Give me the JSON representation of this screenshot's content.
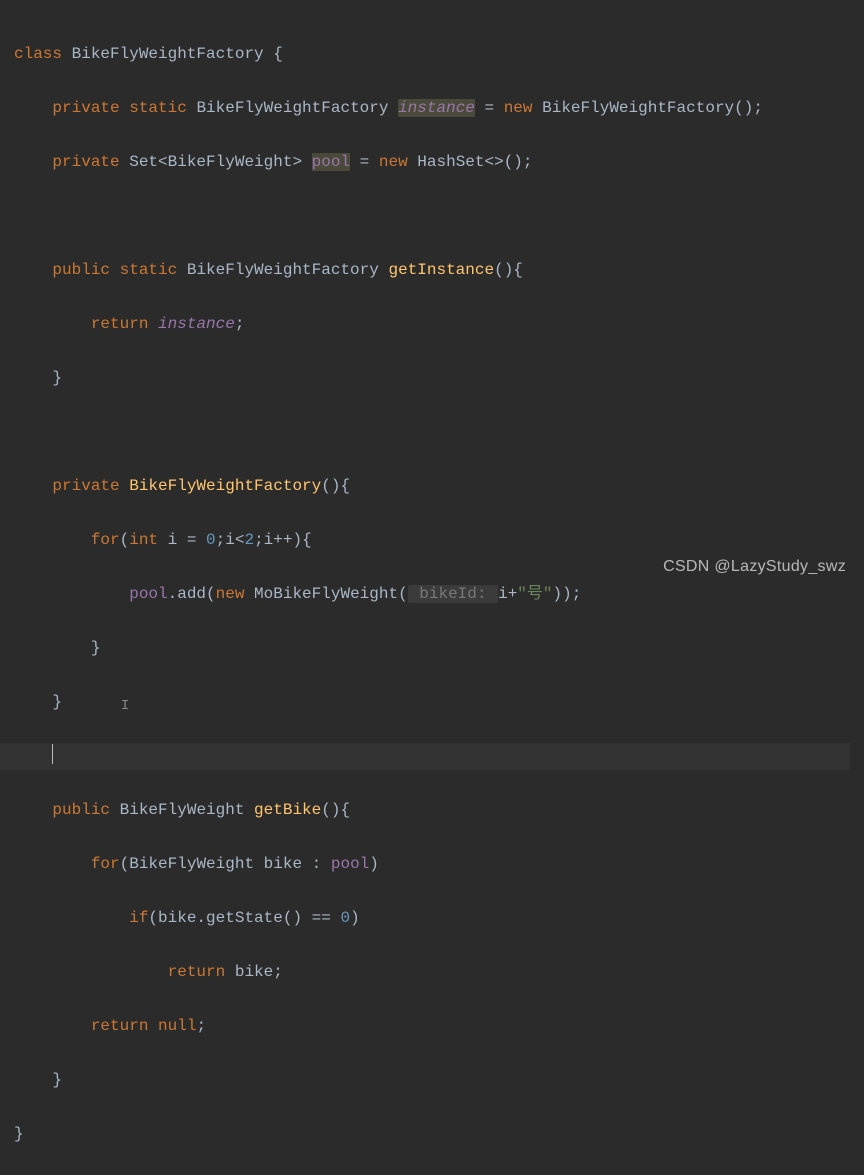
{
  "code": {
    "l1": {
      "a": "class ",
      "b": "BikeFlyWeightFactory {"
    },
    "l2": {
      "a": "    ",
      "b": "private static ",
      "c": "BikeFlyWeightFactory ",
      "d": "instance",
      "e": " = ",
      "f": "new ",
      "g": "BikeFlyWeightFactory();"
    },
    "l3": {
      "a": "    ",
      "b": "private ",
      "c": "Set<BikeFlyWeight> ",
      "d": "pool",
      "e": " = ",
      "f": "new ",
      "g": "HashSet<>();"
    },
    "l4": {
      "a": ""
    },
    "l5": {
      "a": "    ",
      "b": "public static ",
      "c": "BikeFlyWeightFactory ",
      "d": "getInstance",
      "e": "(){"
    },
    "l6": {
      "a": "        ",
      "b": "return ",
      "c": "instance",
      "d": ";"
    },
    "l7": {
      "a": "    }"
    },
    "l8": {
      "a": ""
    },
    "l9": {
      "a": "    ",
      "b": "private ",
      "c": "BikeFlyWeightFactory",
      "d": "(){"
    },
    "l10": {
      "a": "        ",
      "b": "for",
      "c": "(",
      "d": "int ",
      "e": "i = ",
      "f": "0",
      "g": ";i<",
      "h": "2",
      "i": ";i++){"
    },
    "l11": {
      "a": "            ",
      "b": "pool",
      "c": ".add(",
      "d": "new ",
      "e": "MoBikeFlyWeight(",
      "f": " bikeId: ",
      "g": "i+",
      "h": "\"号\"",
      "i": "));"
    },
    "l12": {
      "a": "        }"
    },
    "l13": {
      "a": "    }"
    },
    "l14": {
      "a": "    "
    },
    "l15": {
      "a": "    ",
      "b": "public ",
      "c": "BikeFlyWeight ",
      "d": "getBike",
      "e": "(){"
    },
    "l16": {
      "a": "        ",
      "b": "for",
      "c": "(BikeFlyWeight bike : ",
      "d": "pool",
      "e": ")"
    },
    "l17": {
      "a": "            ",
      "b": "if",
      "c": "(bike.getState() == ",
      "d": "0",
      "e": ")"
    },
    "l18": {
      "a": "                ",
      "b": "return ",
      "c": "bike;"
    },
    "l19": {
      "a": "        ",
      "b": "return null",
      "c": ";"
    },
    "l20": {
      "a": "    }"
    },
    "l21": {
      "a": "}"
    }
  },
  "watermark": "CSDN @LazyStudy_swz"
}
